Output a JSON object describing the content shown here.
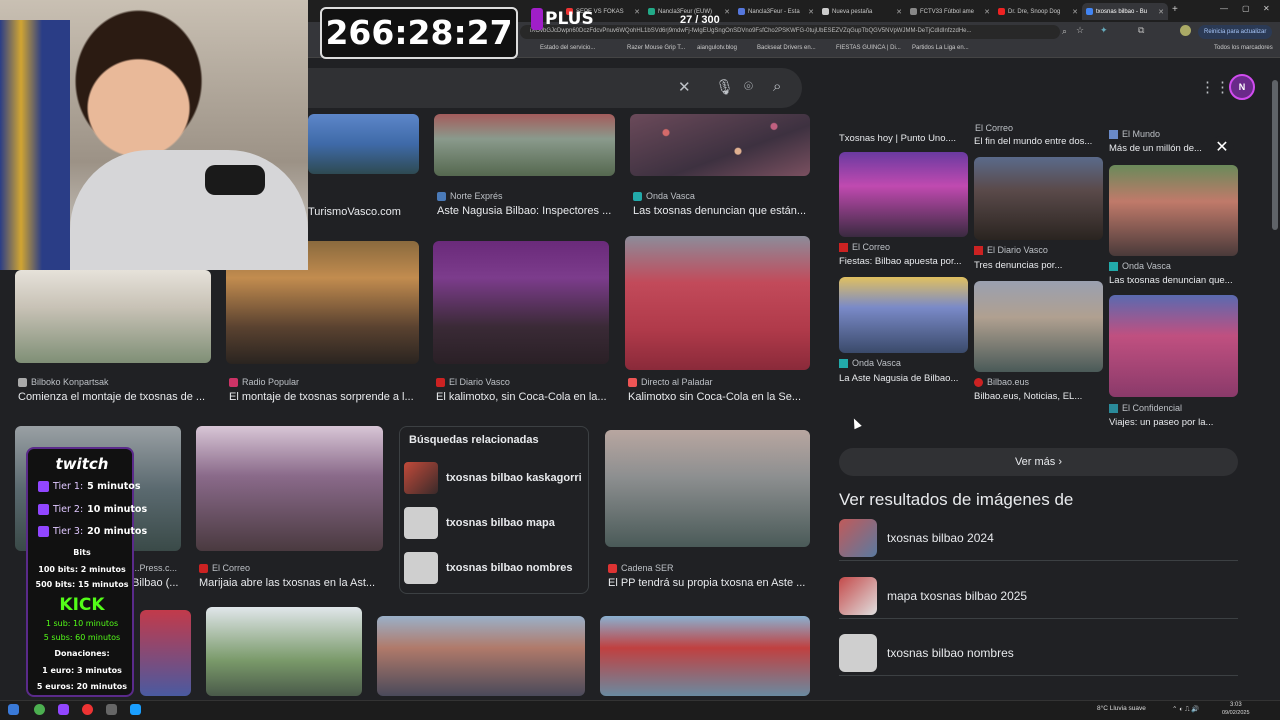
{
  "browser": {
    "tabs": [
      {
        "label": "SEPE VS FOKAS",
        "active": false
      },
      {
        "label": "Nancla3Feur (EUW)",
        "active": false
      },
      {
        "label": "Nancla3Feur - Esta",
        "active": false
      },
      {
        "label": "Nueva pestaña",
        "active": false
      },
      {
        "label": "FCTV33 Fútbol ame",
        "active": false
      },
      {
        "label": "Dr. Dre, Snoop Dog",
        "active": false
      },
      {
        "label": "txosnas bilbao - Bu",
        "active": true
      }
    ],
    "url": "iXOvbGJcDwpn60DczFdcvPnuv6WQohHL1bSVd6rj9mdwFj-fwIgEUgSngOnSDVno9FsfCho2PSKWFG-0tujUbESEZVZqGupTbQGV5NVpWJMM-DeTjCdIdInfzzdHe...",
    "update_label": "Reinicia para actualizar",
    "bookmarks": [
      "Estado del servicio...",
      "Razer Mouse Grip T...",
      "aiangulotv.blog",
      "Backseat Drivers en...",
      "FIESTAS GUINCA | Di...",
      "Partidos La Liga en..."
    ],
    "all_bookmarks": "Todos los marcadores"
  },
  "overlay": {
    "timer": "266:28:27",
    "plus": "PLUS",
    "counter": "27 / 300",
    "subs": {
      "twitch": "twitch",
      "tier1": "Tier 1:",
      "tier1_val": "5 minutos",
      "tier2": "Tier 2:",
      "tier2_val": "10 minutos",
      "tier3": "Tier 3:",
      "tier3_val": "20 minutos",
      "bits": "Bits",
      "bits1": "100 bits: 2 minutos",
      "bits2": "500 bits: 15 minutos",
      "kick": "KICK",
      "kick1": "1 sub: 10 minutos",
      "kick2": "5 subs: 60 minutos",
      "donations": "Donaciones:",
      "don1": "1 euro: 3 minutos",
      "don2": "5 euros: 20 minutos"
    }
  },
  "results": {
    "row1": [
      {
        "source": "",
        "title": "TurismoVasco.com"
      },
      {
        "source": "Norte Exprés",
        "title": "Aste Nagusia Bilbao: Inspectores ..."
      },
      {
        "source": "Onda Vasca",
        "title": "Las txosnas denuncian que están..."
      }
    ],
    "row2": [
      {
        "source": "Bilboko Konpartsak",
        "title": "Comienza el montaje de txosnas de ..."
      },
      {
        "source": "Radio Popular",
        "title": "El montaje de txosnas sorprende a l..."
      },
      {
        "source": "El Diario Vasco",
        "title": "El kalimotxo, sin Coca-Cola en la..."
      },
      {
        "source": "Directo al Paladar",
        "title": "Kalimotxo sin Coca-Cola en la Se..."
      }
    ],
    "row3": [
      {
        "source": "...Press.c...",
        "title": "Bilbao (..."
      },
      {
        "source": "El Correo",
        "title": "Marijaia abre las txosnas en la Ast..."
      },
      {
        "source": "Cadena SER",
        "title": "El PP tendrá su propia txosna en Aste ..."
      }
    ],
    "related": {
      "heading": "Búsquedas relacionadas",
      "items": [
        "txosnas bilbao kaskagorri",
        "txosnas bilbao mapa",
        "txosnas bilbao nombres"
      ]
    }
  },
  "panel": {
    "top_titles": [
      "Txosnas hoy | Punto Uno....",
      "El fin del mundo entre dos...",
      "Más de un millón de..."
    ],
    "top_sources": [
      "El Correo",
      "El Mundo"
    ],
    "grid": [
      {
        "source": "El Correo",
        "title": "Fiestas: Bilbao apuesta por..."
      },
      {
        "source": "El Diario Vasco",
        "title": "Tres denuncias por..."
      },
      {
        "source": "Onda Vasca",
        "title": "Las txosnas denuncian que..."
      },
      {
        "source": "Onda Vasca",
        "title": "La Aste Nagusia de Bilbao..."
      },
      {
        "source": "Bilbao.eus",
        "title": "Bilbao.eus, Noticias, EL..."
      },
      {
        "source": "El Confidencial",
        "title": "Viajes: un paseo por la..."
      }
    ],
    "more": "Ver más",
    "see_results_heading": "Ver resultados de imágenes de",
    "see_results": [
      "txosnas bilbao 2024",
      "mapa txosnas bilbao 2025",
      "txosnas bilbao nombres"
    ]
  },
  "taskbar": {
    "weather": "8°C  Lluvia suave",
    "time": "3:03",
    "date": "09/02/2025"
  }
}
